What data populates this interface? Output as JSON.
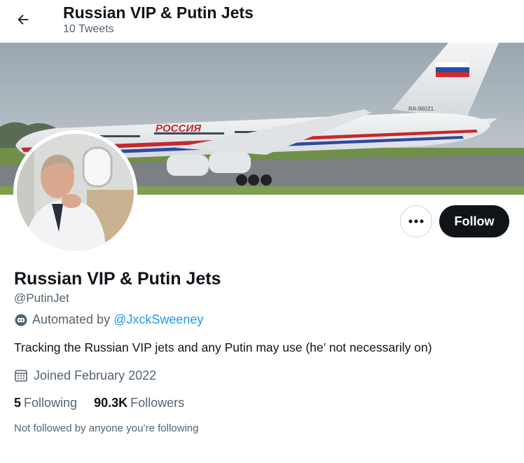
{
  "header": {
    "title": "Russian VIP & Putin Jets",
    "tweet_count": "10 Tweets"
  },
  "banner": {
    "aircraft_livery_text": "РОССИЯ",
    "registration": "RA-96021"
  },
  "actions": {
    "more_icon": "more-dots-icon",
    "follow_label": "Follow"
  },
  "profile": {
    "name": "Russian VIP & Putin Jets",
    "handle": "@PutinJet",
    "automated_prefix": "Automated by",
    "automated_by": "@JxckSweeney",
    "bio": "Tracking the Russian VIP jets and any Putin may use (he’ not necessarily on)",
    "joined": "Joined February 2022"
  },
  "stats": {
    "following_count": "5",
    "following_label": "Following",
    "followers_count": "90.3K",
    "followers_label": "Followers"
  },
  "footer_note": "Not followed by anyone you’re following",
  "colors": {
    "accent": "#1d9bf0",
    "text_primary": "#0f1419",
    "text_secondary": "#536471",
    "follow_button": "#0f1419"
  }
}
